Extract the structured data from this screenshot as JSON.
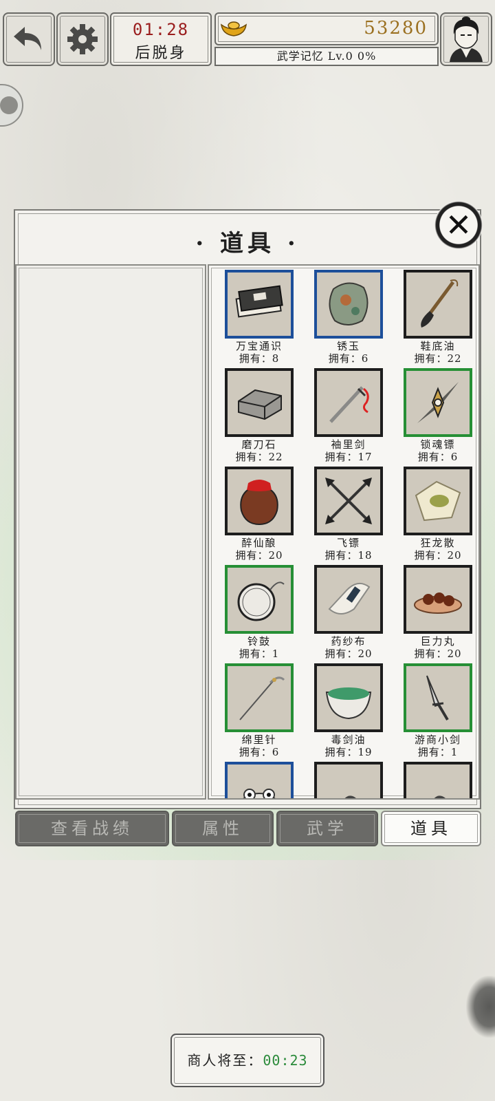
{
  "top_bar": {
    "back_icon": "undo-arrow-icon",
    "settings_icon": "gear-icon",
    "timer": {
      "time": "01:28",
      "label": "后脱身"
    },
    "gold": {
      "icon": "gold-ingot-icon",
      "value": "53280"
    },
    "martial_memory": "武学记忆 Lv.0 0%",
    "avatar_icon": "character-portrait-icon"
  },
  "panel": {
    "title": "· 道具 ·",
    "close_icon": "close-icon",
    "items": [
      {
        "name": "万宝通识",
        "count": "拥有：8",
        "rarity": "blue",
        "icon": "book-icon"
      },
      {
        "name": "锈玉",
        "count": "拥有：6",
        "rarity": "blue",
        "icon": "jade-stone-icon"
      },
      {
        "name": "鞋底油",
        "count": "拥有：22",
        "rarity": "black",
        "icon": "brush-icon"
      },
      {
        "name": "磨刀石",
        "count": "拥有：22",
        "rarity": "black",
        "icon": "whetstone-icon"
      },
      {
        "name": "袖里剑",
        "count": "拥有：17",
        "rarity": "black",
        "icon": "sleeve-sword-icon"
      },
      {
        "name": "锁魂镖",
        "count": "拥有：6",
        "rarity": "green",
        "icon": "dart-icon"
      },
      {
        "name": "醉仙酿",
        "count": "拥有：20",
        "rarity": "black",
        "icon": "wine-jar-icon"
      },
      {
        "name": "飞镖",
        "count": "拥有：18",
        "rarity": "black",
        "icon": "crossed-darts-icon"
      },
      {
        "name": "狂龙散",
        "count": "拥有：20",
        "rarity": "black",
        "icon": "powder-packet-icon"
      },
      {
        "name": "铃鼓",
        "count": "拥有：1",
        "rarity": "green",
        "icon": "tambourine-icon"
      },
      {
        "name": "药纱布",
        "count": "拥有：20",
        "rarity": "black",
        "icon": "bandage-icon"
      },
      {
        "name": "巨力丸",
        "count": "拥有：20",
        "rarity": "black",
        "icon": "pills-bowl-icon"
      },
      {
        "name": "绵里针",
        "count": "拥有：6",
        "rarity": "green",
        "icon": "needle-icon"
      },
      {
        "name": "毒剑油",
        "count": "拥有：19",
        "rarity": "black",
        "icon": "poison-bowl-icon"
      },
      {
        "name": "游商小剑",
        "count": "拥有：1",
        "rarity": "green",
        "icon": "dagger-icon"
      },
      {
        "name": "",
        "count": "",
        "rarity": "blue",
        "icon": "frog-icon"
      },
      {
        "name": "",
        "count": "",
        "rarity": "black",
        "icon": "unknown-item-icon"
      },
      {
        "name": "",
        "count": "",
        "rarity": "black",
        "icon": "unknown-item-icon"
      }
    ]
  },
  "tabs": [
    {
      "label": "查看战绩",
      "active": false
    },
    {
      "label": "属性",
      "active": false
    },
    {
      "label": "武学",
      "active": false
    },
    {
      "label": "道具",
      "active": true
    }
  ],
  "merchant": {
    "label": "商人将至：",
    "time": "00:23"
  },
  "colors": {
    "timer_red": "#9a1e1e",
    "gold": "#9b7020",
    "rarity_blue": "#1d4f9a",
    "rarity_green": "#268f35",
    "merchant_green": "#2a8a3a"
  }
}
